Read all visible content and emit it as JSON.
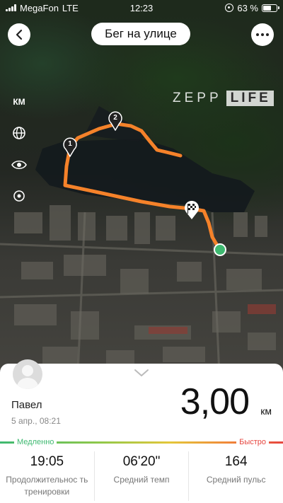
{
  "status_bar": {
    "carrier": "MegaFon",
    "network": "LTE",
    "time": "12:23",
    "battery": "63 %",
    "battery_level": 0.63
  },
  "header": {
    "title": "Бег на улице"
  },
  "map": {
    "brand_left": "ZEPP",
    "brand_right": "LIFE",
    "unit_toggle": "КМ",
    "markers": [
      "1",
      "2"
    ],
    "route_color": "#f5822a",
    "end_marker_color": "#3fb971"
  },
  "summary": {
    "user_name": "Павел",
    "date": "5 апр., 08:21",
    "distance": "3,00",
    "distance_unit": "км"
  },
  "pace_scale": {
    "slow_label": "Медленно",
    "fast_label": "Быстро",
    "slow_color": "#3fb971",
    "fast_color": "#e6463f"
  },
  "stats": [
    {
      "value": "19:05",
      "label": "Продолжительнос ть тренировки"
    },
    {
      "value": "06'20\"",
      "label": "Средний темп"
    },
    {
      "value": "164",
      "label": "Средний пульс"
    }
  ]
}
